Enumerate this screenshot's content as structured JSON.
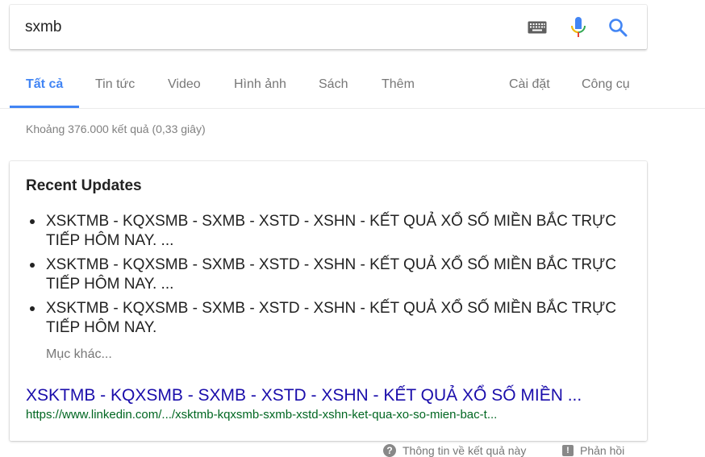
{
  "search": {
    "query": "sxmb"
  },
  "icons": {
    "keyboard": "keyboard-icon",
    "mic": "microphone-icon",
    "search": "search-icon"
  },
  "colors": {
    "accent_blue": "#4285f4",
    "link_blue": "#1a0dab",
    "url_green": "#006621",
    "mic_red": "#ea4335",
    "mic_blue": "#4285f4",
    "mic_yellow": "#fbbc05",
    "mic_green": "#34a853"
  },
  "tabs": [
    {
      "label": "Tất cả",
      "active": true
    },
    {
      "label": "Tin tức"
    },
    {
      "label": "Video"
    },
    {
      "label": "Hình ảnh"
    },
    {
      "label": "Sách"
    },
    {
      "label": "Thêm"
    },
    {
      "label": "Cài đặt"
    },
    {
      "label": "Công cụ"
    }
  ],
  "result_stats": "Khoảng 376.000 kết quả (0,33 giây)",
  "card": {
    "title": "Recent Updates",
    "updates": [
      "XSKTMB - KQXSMB - SXMB - XSTD - XSHN - KẾT QUẢ XỔ SỐ MIỀN BẮC TRỰC TIẾP HÔM NAY. ...",
      "XSKTMB - KQXSMB - SXMB - XSTD - XSHN - KẾT QUẢ XỔ SỐ MIỀN BẮC TRỰC TIẾP HÔM NAY. ...",
      "XSKTMB - KQXSMB - SXMB - XSTD - XSHN - KẾT QUẢ XỔ SỐ MIỀN BẮC TRỰC TIẾP HÔM NAY."
    ],
    "more": "Mục khác...",
    "result_title": "XSKTMB - KQXSMB - SXMB - XSTD - XSHN - KẾT QUẢ XỔ SỐ MIỀN ...",
    "result_url": "https://www.linkedin.com/.../xsktmb-kqxsmb-sxmb-xstd-xshn-ket-qua-xo-so-mien-bac-t..."
  },
  "footer": {
    "info_label": "Thông tin về kết quả này",
    "feedback_label": "Phản hồi"
  }
}
